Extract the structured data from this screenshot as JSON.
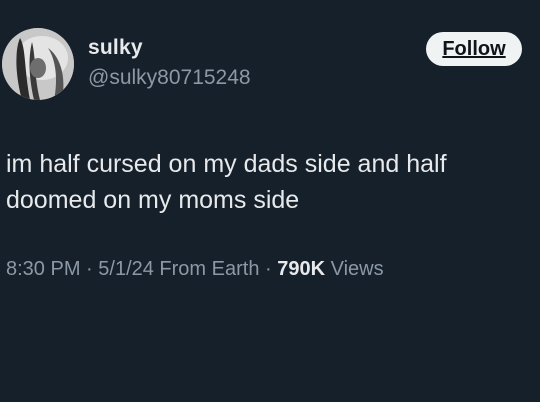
{
  "author": {
    "display_name": "sulky",
    "handle": "@sulky80715248"
  },
  "follow_label": "Follow",
  "tweet": {
    "text_line1": "im half cursed on my dads side and half",
    "text_line2": "doomed on my moms side"
  },
  "meta": {
    "time": "8:30 PM",
    "separator1": " · ",
    "date": "5/1/24",
    "source": " From Earth",
    "separator2": " · ",
    "views_count": "790K",
    "views_label": " Views"
  },
  "colors": {
    "background": "#15202b",
    "primary_text": "#e7e9ea",
    "secondary_text": "#8b98a5",
    "follow_button_bg": "#eff3f4"
  },
  "icons": {
    "avatar": "profile-photo"
  }
}
